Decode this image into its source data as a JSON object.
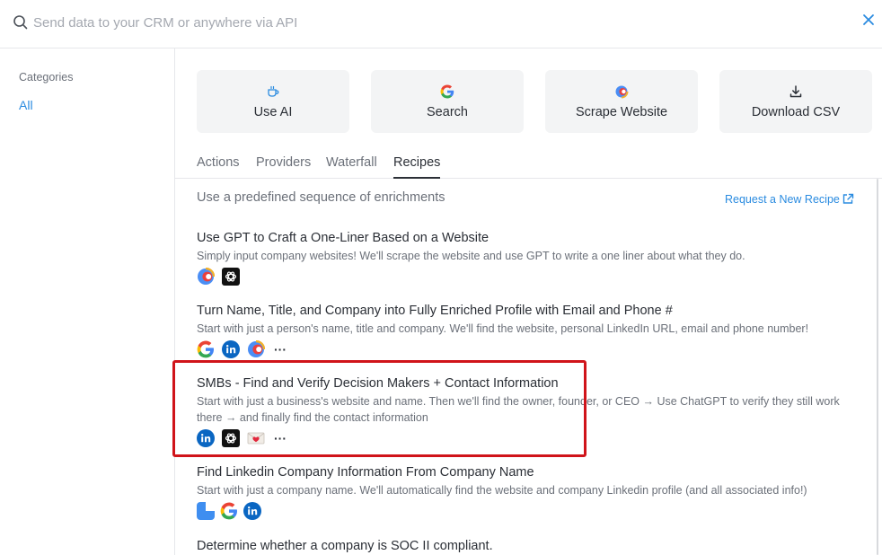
{
  "search": {
    "placeholder": "Send data to your CRM or anywhere via API",
    "value": ""
  },
  "sidebar": {
    "heading": "Categories",
    "items": [
      {
        "label": "All",
        "active": true
      }
    ]
  },
  "quick_actions": [
    {
      "label": "Use AI",
      "icon": "coffee-cup-icon"
    },
    {
      "label": "Search",
      "icon": "google-icon"
    },
    {
      "label": "Scrape Website",
      "icon": "clay-icon"
    },
    {
      "label": "Download CSV",
      "icon": "download-icon"
    }
  ],
  "tabs": [
    {
      "label": "Actions",
      "active": false
    },
    {
      "label": "Providers",
      "active": false
    },
    {
      "label": "Waterfall",
      "active": false
    },
    {
      "label": "Recipes",
      "active": true
    }
  ],
  "content": {
    "intro": "Use a predefined sequence of enrichments",
    "request_link": "Request a New Recipe",
    "recipes": [
      {
        "title": "Use GPT to Craft a One-Liner Based on a Website",
        "description": "Simply input company websites! We'll scrape the website and use GPT to write a one liner about what they do.",
        "icons": [
          "clay-icon",
          "openai-icon"
        ],
        "more": false
      },
      {
        "title": "Turn Name, Title, and Company into Fully Enriched Profile with Email and Phone #",
        "description": "Start with just a person's name, title and company. We'll find the website, personal LinkedIn URL, email and phone number!",
        "icons": [
          "google-icon",
          "linkedin-icon",
          "clay-icon"
        ],
        "more": true
      },
      {
        "title": "SMBs - Find and Verify Decision Makers + Contact Information",
        "description": "Start with just a business's website and name. Then we'll find the owner, founder, or CEO → Use ChatGPT to verify they still work there → and finally find the contact information",
        "icons": [
          "linkedin-icon",
          "openai-icon",
          "mail-heart-icon"
        ],
        "more": true
      },
      {
        "title": "Find Linkedin Company Information From Company Name",
        "description": "Start with just a company name. We'll automatically find the website and company Linkedin profile (and all associated info!)",
        "icons": [
          "blue-tile-icon",
          "google-icon",
          "linkedin-icon"
        ],
        "more": false
      },
      {
        "title": "Determine whether a company is SOC II compliant.",
        "description": "",
        "icons": [],
        "more": false
      }
    ],
    "more_label": "···"
  },
  "colors": {
    "accent": "#2a8be0",
    "highlight": "#d0141a",
    "card_bg": "#f3f4f5"
  }
}
